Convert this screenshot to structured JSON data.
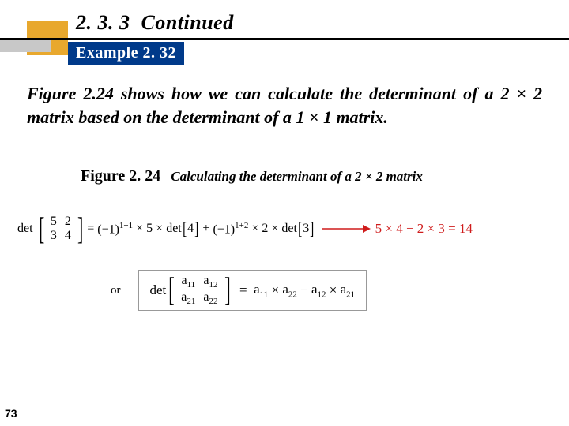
{
  "section": {
    "number": "2. 3. 3",
    "word": "Continued"
  },
  "example": {
    "label": "Example 2. 32"
  },
  "body": "Figure 2.24 shows how we can calculate the determinant of a 2 × 2 matrix based on the determinant of a 1 × 1 matrix.",
  "figure": {
    "label": "Figure 2. 24",
    "desc": "Calculating the determinant of a 2 × 2 matrix"
  },
  "eq": {
    "det": "det",
    "m00": "5",
    "m01": "2",
    "m10": "3",
    "m11": "4",
    "eq": "=",
    "t1a": "(−1)",
    "t1exp": "1+1",
    "times": "×",
    "five": "5",
    "four_s": "4",
    "plus": "+",
    "t2a": "(−1)",
    "t2exp": "1+2",
    "two": "2",
    "three_s": "3",
    "result": "5 × 4 − 2 × 3 = 14"
  },
  "or": {
    "label": "or",
    "det": "det",
    "a11": "a",
    "s11": "11",
    "a12": "a",
    "s12": "12",
    "a21": "a",
    "s21": "21",
    "a22": "a",
    "s22": "22",
    "rhs_eq": "=",
    "times": "×",
    "minus": "−"
  },
  "page": "73"
}
